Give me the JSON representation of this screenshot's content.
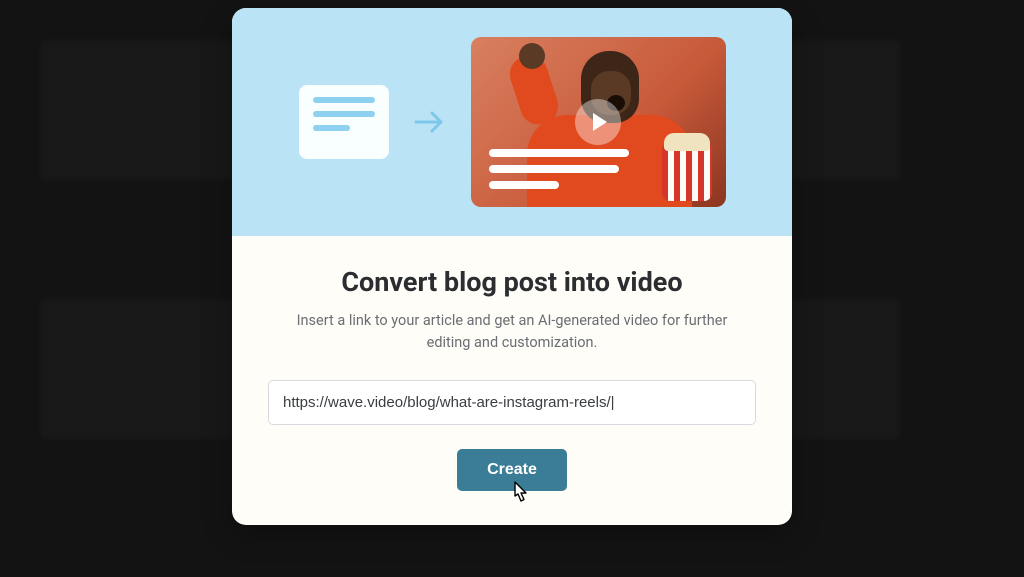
{
  "modal": {
    "title": "Convert blog post into video",
    "subtitle": "Insert a link to your article and get an AI-generated video for further editing and customization.",
    "url_value": "https://wave.video/blog/what-are-instagram-reels/|",
    "create_label": "Create"
  },
  "colors": {
    "hero_bg": "#bbe3f6",
    "accent": "#3b7d96",
    "overlay": "rgba(0,0,0,0.55)"
  }
}
